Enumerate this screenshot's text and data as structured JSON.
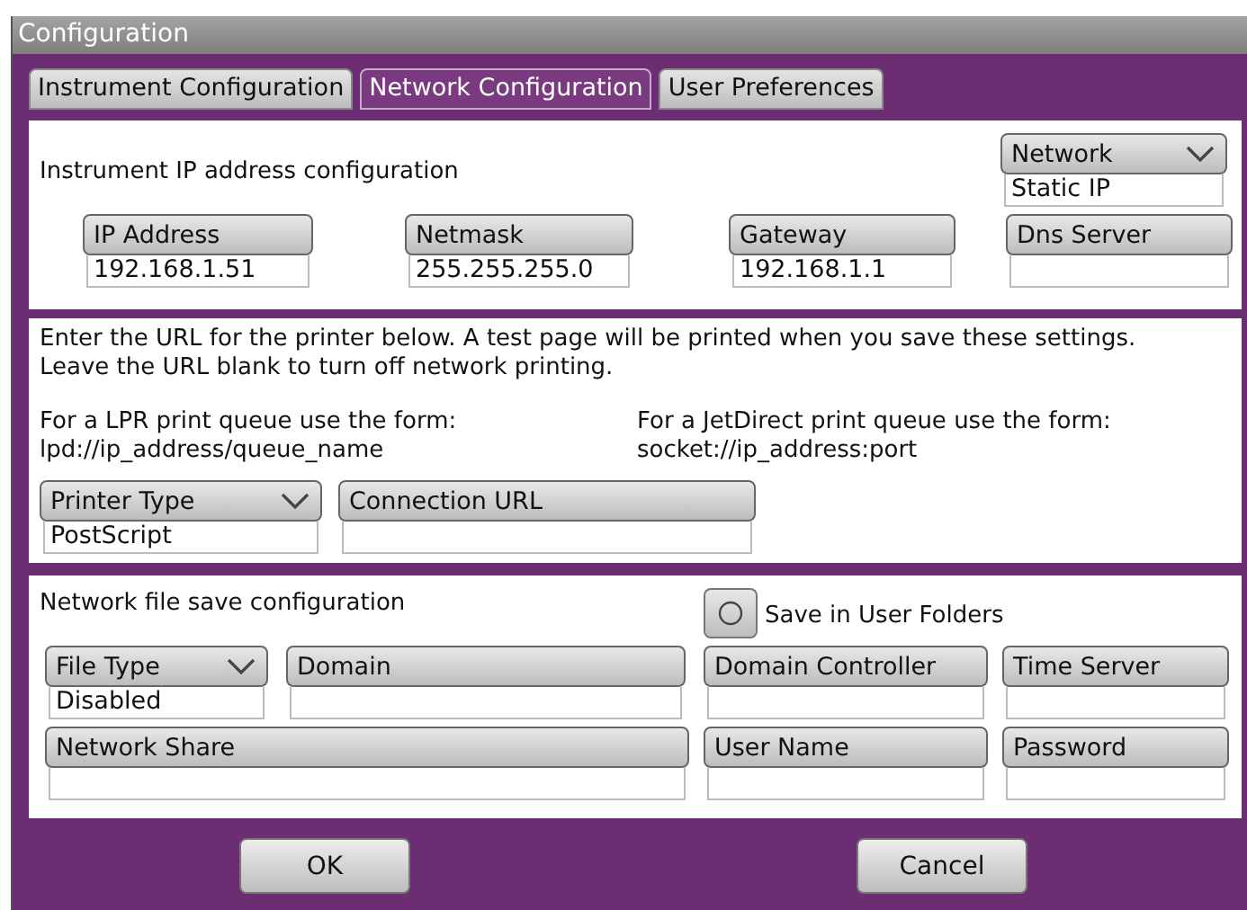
{
  "window": {
    "title": "Configuration"
  },
  "tabs": [
    {
      "label": "Instrument Configuration",
      "selected": false
    },
    {
      "label": "Network Configuration",
      "selected": true
    },
    {
      "label": "User Preferences",
      "selected": false
    }
  ],
  "ip_section": {
    "heading": "Instrument IP address configuration",
    "mode": {
      "kind": "dropdown",
      "label": "Network",
      "value": "Static IP"
    },
    "fields": [
      {
        "kind": "text",
        "label": "IP Address",
        "value": "192.168.1.51"
      },
      {
        "kind": "text",
        "label": "Netmask",
        "value": "255.255.255.0"
      },
      {
        "kind": "text",
        "label": "Gateway",
        "value": "192.168.1.1"
      },
      {
        "kind": "text",
        "label": "Dns Server"
      }
    ]
  },
  "printer_section": {
    "intro": [
      "Enter the URL for the printer below. A test page will be printed when you save these settings.",
      "Leave the URL blank to turn off network printing."
    ],
    "forms": [
      [
        "For a LPR print queue use the form:",
        "lpd://ip_address/queue_name"
      ],
      [
        "For a JetDirect print queue use the form:",
        "socket://ip_address:port"
      ]
    ],
    "fields": [
      {
        "kind": "dropdown",
        "label": "Printer Type",
        "value": "PostScript"
      },
      {
        "kind": "text",
        "label": "Connection URL"
      }
    ]
  },
  "file_section": {
    "heading": "Network file save configuration",
    "save_in_user_folders": {
      "label": "Save in User Folders",
      "checked": false
    },
    "fields": [
      {
        "kind": "dropdown",
        "label": "File Type",
        "value": "Disabled"
      },
      {
        "kind": "text",
        "label": "Domain"
      },
      {
        "kind": "text",
        "label": "Domain Controller"
      },
      {
        "kind": "text",
        "label": "Time Server"
      },
      {
        "kind": "text",
        "label": "Network Share"
      },
      {
        "kind": "text",
        "label": "User Name"
      },
      {
        "kind": "text",
        "label": "Password"
      }
    ]
  },
  "buttons": [
    "OK",
    "Cancel"
  ]
}
